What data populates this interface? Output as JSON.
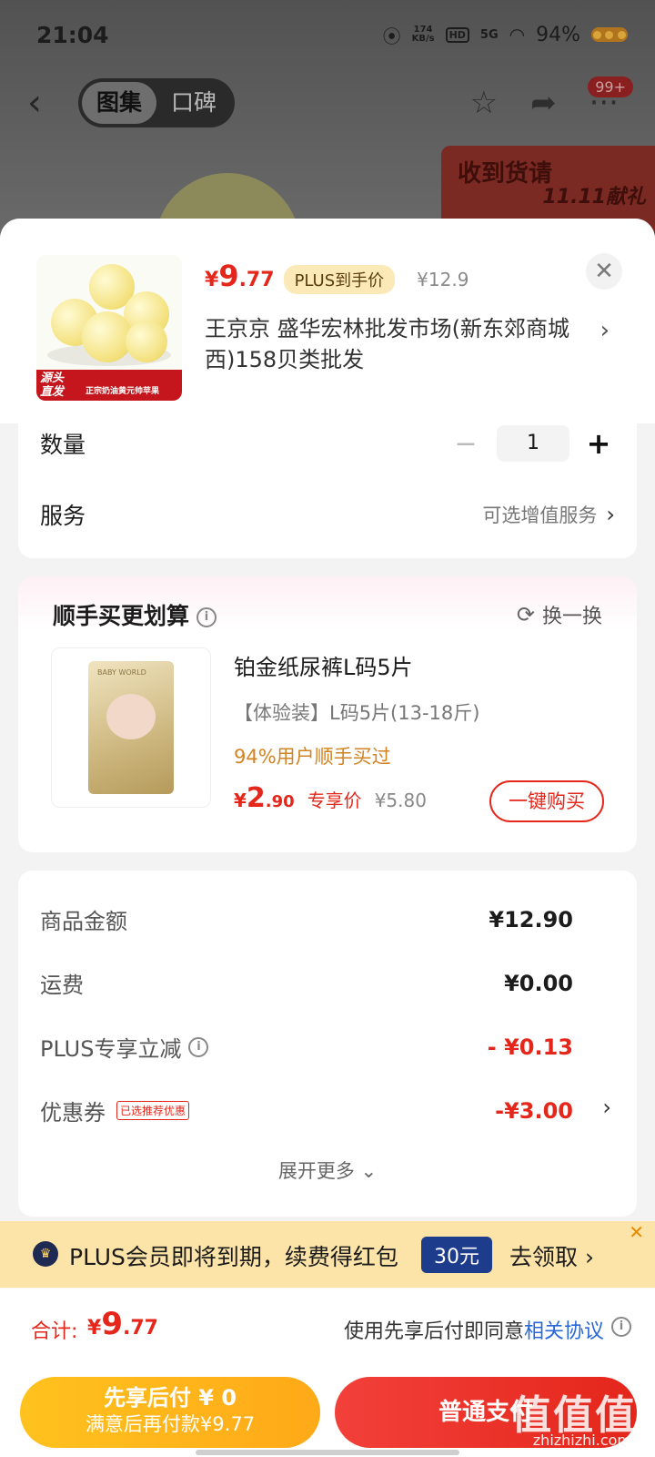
{
  "status": {
    "time": "21:04",
    "speed_value": "174",
    "speed_unit": "KB/s",
    "hd": "HD",
    "network": "5G",
    "battery": "94%"
  },
  "nav": {
    "tabs": [
      {
        "label": "图集",
        "active": true
      },
      {
        "label": "口碑",
        "active": false
      }
    ],
    "cart_badge": "99+"
  },
  "bg_banner": {
    "title": "收到货请",
    "promo": "11.11献礼"
  },
  "product": {
    "price_symbol": "¥",
    "price_int": "9",
    "price_dec": ".77",
    "price_tag": "PLUS到手价",
    "original_price": "¥12.9",
    "shop": "王京京  盛华宏林批发市场(新东郊商城西)158贝类批发",
    "thumb_tag_left": "源头\n直发",
    "thumb_tag_right": "正宗奶油黄元帅苹果"
  },
  "options": {
    "qty_label": "数量",
    "qty_value": "1",
    "qty_minus": "−",
    "qty_plus": "+",
    "service_label": "服务",
    "service_value": "可选增值服务"
  },
  "upsell": {
    "title": "顺手买更划算",
    "swap_label": "换一换",
    "item_name": "铂金纸尿裤L码5片",
    "item_spec": "【体验装】L码5片(13-18斤)",
    "item_tip": "94%用户顺手买过",
    "price_symbol": "¥",
    "price_int": "2",
    "price_dec": ".90",
    "price_tag": "专享价",
    "original_price": "¥5.80",
    "buy_button": "一键购买",
    "brand_text": "BABY WORLD"
  },
  "summary": {
    "rows": [
      {
        "label": "商品金额",
        "value": "¥12.90"
      },
      {
        "label": "运费",
        "value": "¥0.00"
      },
      {
        "label": "PLUS专享立减",
        "value": "- ¥0.13"
      },
      {
        "label": "优惠券",
        "value": "-¥3.00",
        "tag": "已选推荐优惠"
      }
    ],
    "expand": "展开更多"
  },
  "plus_bar": {
    "text": "PLUS会员即将到期，续费得红包",
    "amount": "30元",
    "action": "去领取"
  },
  "total": {
    "label": "合计:",
    "symbol": "¥",
    "int": "9",
    "dec": ".77",
    "agreement_prefix": "使用先享后付即同意",
    "agreement_link": "相关协议"
  },
  "buttons": {
    "pay_later_title": "先享后付 ¥ 0",
    "pay_later_sub": "满意后再付款¥9.77",
    "pay_normal": "普通支付"
  },
  "watermark": {
    "text": "值值值",
    "url": "zhizhizhi.com"
  },
  "colors": {
    "accent_red": "#e4261b",
    "plus_gold": "#fbe9b8",
    "pay_later_yellow": "#ffb51c",
    "link_blue": "#2a67d8"
  }
}
